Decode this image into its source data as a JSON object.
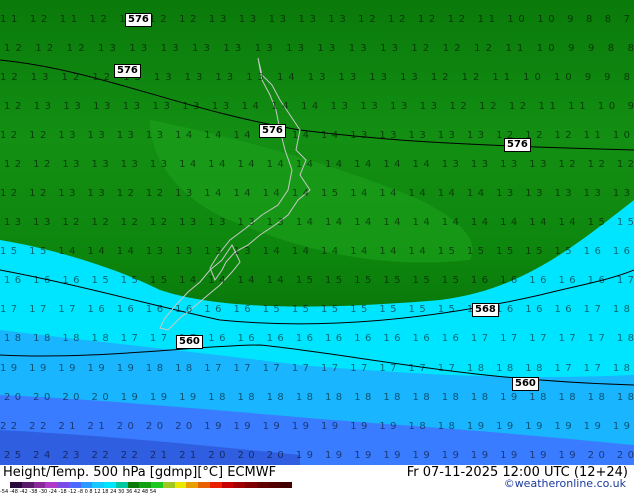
{
  "map": {
    "contour_labels": [
      "576",
      "576",
      "576",
      "576",
      "568",
      "560",
      "560"
    ],
    "background_colors": {
      "dark_green": "#0a7a0a",
      "green": "#138f13",
      "light_green": "#1ea41e",
      "cyan": "#00e5ff",
      "light_blue": "#19b5ff",
      "blue": "#3a7cff"
    },
    "temperature_rows": [
      "11 12 11 12 12 12 12 13 13 13 13 13 12 12 12 12 11 10 10 9 8 8 7",
      "12 12 12 13 13 13 13 13 13 13 13 13 13 12 12 12 11 10 9 9 8 8",
      "12 13 12 12 13 13 13 13 13 14 13 13 13 13 12 12 11 10 10 9 9 8",
      "12 13 13 13 13 13 13 13 14 14 14 13 13 13 13 12 12 12 11 11 10 9",
      "12 12 13 13 13 13 14 14 14 14 14 14 13 13 13 13 13 12 12 12 11 10",
      "12 12 13 13 13 13 14 14 14 14 14 14 14 14 14 13 13 13 13 12 12 12",
      "12 12 13 13 12 12 13 14 14 14 14 15 14 14 14 14 14 13 13 13 13 13",
      "13 13 12 12 12 12 13 13 13 13 14 14 14 14 14 14 14 14 14 14 15 15",
      "15 15 14 14 14 13 13 13 13 14 14 14 14 14 14 15 15 15 15 15 16 16",
      "16 16 16 15 15 15 14 14 14 14 15 15 15 15 15 15 16 16 16 16 16 17",
      "17 17 17 16 16 16 16 16 16 15 15 15 15 15 15 15 15 16 16 16 17 18",
      "18 18 18 18 17 17 17 16 16 16 16 16 16 16 16 16 17 17 17 17 17 18",
      "19 19 19 19 19 18 18 17 17 17 17 17 17 17 17 17 18 18 18 17 17 18",
      "20 20 20 20 19 19 19 18 18 18 18 18 18 18 18 18 18 19 18 18 18 18",
      "22 22 21 21 20 20 20 19 19 19 19 19 19 19 18 18 19 19 19 19 19 19",
      "25 24 23 22 22 21 21 20 20 20 19 19 19 19 19 19 19 19 19 19 20 20"
    ]
  },
  "footer": {
    "title": "Height/Temp. 500 hPa [gdmp][°C] ECMWF",
    "datetime": "Fr 07-11-2025 12:00 UTC (12+24)",
    "credit": "©weatheronline.co.uk",
    "colorbar_colors": [
      "#2a0a3a",
      "#5a1a6a",
      "#8a2a9a",
      "#b03ac8",
      "#7a4ae8",
      "#4a6aff",
      "#2a9aff",
      "#19c8ff",
      "#00e5ff",
      "#00c8a0",
      "#0a7a0a",
      "#13a013",
      "#1ec81e",
      "#a0c81e",
      "#e8e800",
      "#e8a000",
      "#e86000",
      "#e82000",
      "#c80000",
      "#a00000",
      "#800000",
      "#600000",
      "#500000",
      "#400000"
    ],
    "colorbar_ticks": "-54 -48 -42 -38 -30 -24 -18 -12 -8 0 8 12 18 24 30 36 42 48 54"
  }
}
